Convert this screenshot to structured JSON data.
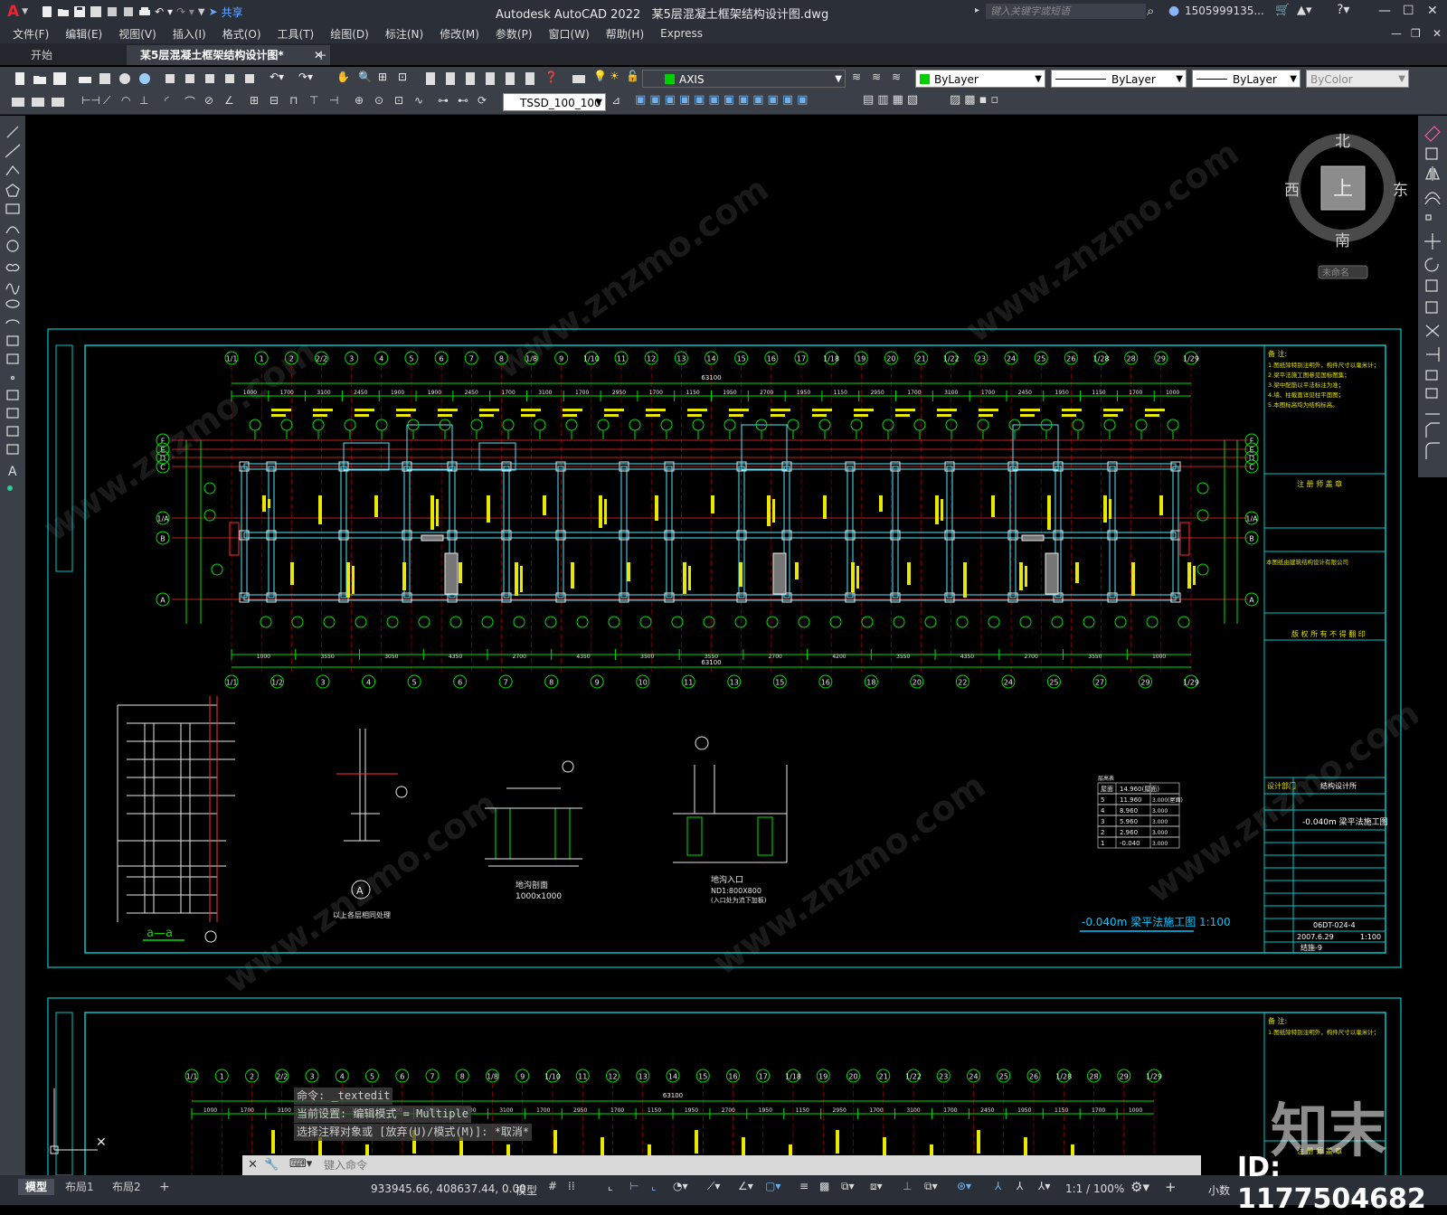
{
  "window": {
    "app_title": "Autodesk AutoCAD 2022",
    "file_title": "某5层混凝土框架结构设计图.dwg",
    "share_label": "共享",
    "search_placeholder": "键入关键字或短语",
    "user": "1505999135...",
    "logo": "A"
  },
  "menu": [
    "文件(F)",
    "编辑(E)",
    "视图(V)",
    "插入(I)",
    "格式(O)",
    "工具(T)",
    "绘图(D)",
    "标注(N)",
    "修改(M)",
    "参数(P)",
    "窗口(W)",
    "帮助(H)",
    "Express"
  ],
  "tabs": {
    "start": "开始",
    "active": "某5层混凝土框架结构设计图*",
    "close": "✕",
    "add": "+"
  },
  "properties": {
    "layer": "AXIS",
    "color": "ByLayer",
    "linetype": "ByLayer",
    "lineweight": "ByLayer",
    "plotstyle": "ByColor",
    "dimstyle": "TSSD_100_100",
    "layer_color": "#00d000"
  },
  "viewcube": {
    "north": "北",
    "south": "南",
    "east": "东",
    "west": "西",
    "top": "上",
    "wcs": "未命名"
  },
  "drawing": {
    "notes_title": "备 注:",
    "notes": [
      "1.图纸除特别注明外，构件尺寸以毫米计；",
      "2.梁平法施工图参见国标图集；",
      "3.梁中配筋以平法标注为准；",
      "4.墙、柱截面详见柱平面图；",
      "5.本图标高均为结构标高。"
    ],
    "rev_title": "注 册 师 盖 章",
    "company": "本图纸由建筑结构设计有限公司",
    "copyright": "版 权 所 有 不 得 翻 印",
    "table_title": "层高表",
    "dept": "设计部门",
    "dept_name": "结构设计所",
    "drawing_name": "-0.040m 梁平法施工图",
    "drawing_no": "06DT-024-4",
    "date": "2007.6.29",
    "scale": "1:100",
    "sheet": "结施-9",
    "main_title": "-0.040m 梁平法施工图 1:100",
    "detail_section": "a—a",
    "detail_a_label": "以上各层相同处理",
    "detail_pit": "地沟剖面",
    "detail_pit_size": "1000x1000",
    "detail_entry": "地沟入口",
    "detail_entry_note": "ND1:800X800",
    "detail_entry_sub": "(入口处为流下加板)",
    "overall_dim": "63100",
    "top_axes": [
      "1/1",
      "1",
      "2",
      "2/2",
      "3",
      "4",
      "5",
      "6",
      "7",
      "8",
      "1/8",
      "9",
      "1/10",
      "11",
      "12",
      "13",
      "14",
      "15",
      "16",
      "17",
      "1/18",
      "19",
      "20",
      "21",
      "1/22",
      "23",
      "24",
      "25",
      "26",
      "1/28",
      "28",
      "29",
      "1/29"
    ],
    "bot_axes": [
      "1/1",
      "1/2",
      "3",
      "4",
      "5",
      "6",
      "7",
      "8",
      "9",
      "10",
      "11",
      "13",
      "15",
      "16",
      "18",
      "20",
      "22",
      "24",
      "25",
      "27",
      "29",
      "1/29"
    ],
    "row_axes": [
      "F",
      "E",
      "D",
      "C",
      "1/A",
      "B",
      "A"
    ],
    "top_dims": [
      "1000",
      "1700",
      "3100",
      "2450",
      "1900",
      "1900",
      "2450",
      "1700",
      "3100",
      "1700",
      "2950",
      "1700",
      "1150",
      "1950",
      "2700",
      "1950",
      "1150",
      "2950",
      "1700",
      "3100",
      "1700",
      "2450",
      "1950",
      "1150",
      "1700",
      "1000"
    ],
    "bot_dims": [
      "1000",
      "3550",
      "3050",
      "4350",
      "2700",
      "4350",
      "3500",
      "3550",
      "2700",
      "4200",
      "3550",
      "4350",
      "2700",
      "3550",
      "1000"
    ],
    "levels": [
      {
        "floor": "屋面",
        "h": "14.960(屋面)",
        "hh": ""
      },
      {
        "floor": "5",
        "h": "11.960",
        "hh": "3.000(屋面)"
      },
      {
        "floor": "4",
        "h": "8.960",
        "hh": "3.000"
      },
      {
        "floor": "3",
        "h": "5.960",
        "hh": "3.000"
      },
      {
        "floor": "2",
        "h": "2.960",
        "hh": "3.000"
      },
      {
        "floor": "1",
        "h": "-0.040",
        "hh": "3.000"
      }
    ]
  },
  "command": {
    "history": [
      "命令: _textedit",
      "当前设置: 编辑模式 = Multiple",
      "选择注释对象或 [放弃(U)/模式(M)]: *取消*"
    ],
    "placeholder": "键入命令"
  },
  "status": {
    "layouts": [
      "模型",
      "布局1",
      "布局2"
    ],
    "coords": "933945.66, 408637.44, 0.00",
    "space": "模型",
    "scale": "1:1 / 100%",
    "units": "小数"
  },
  "watermark": {
    "site": "www.znzmo.com",
    "logo": "知末",
    "id": "ID: 1177504682"
  }
}
